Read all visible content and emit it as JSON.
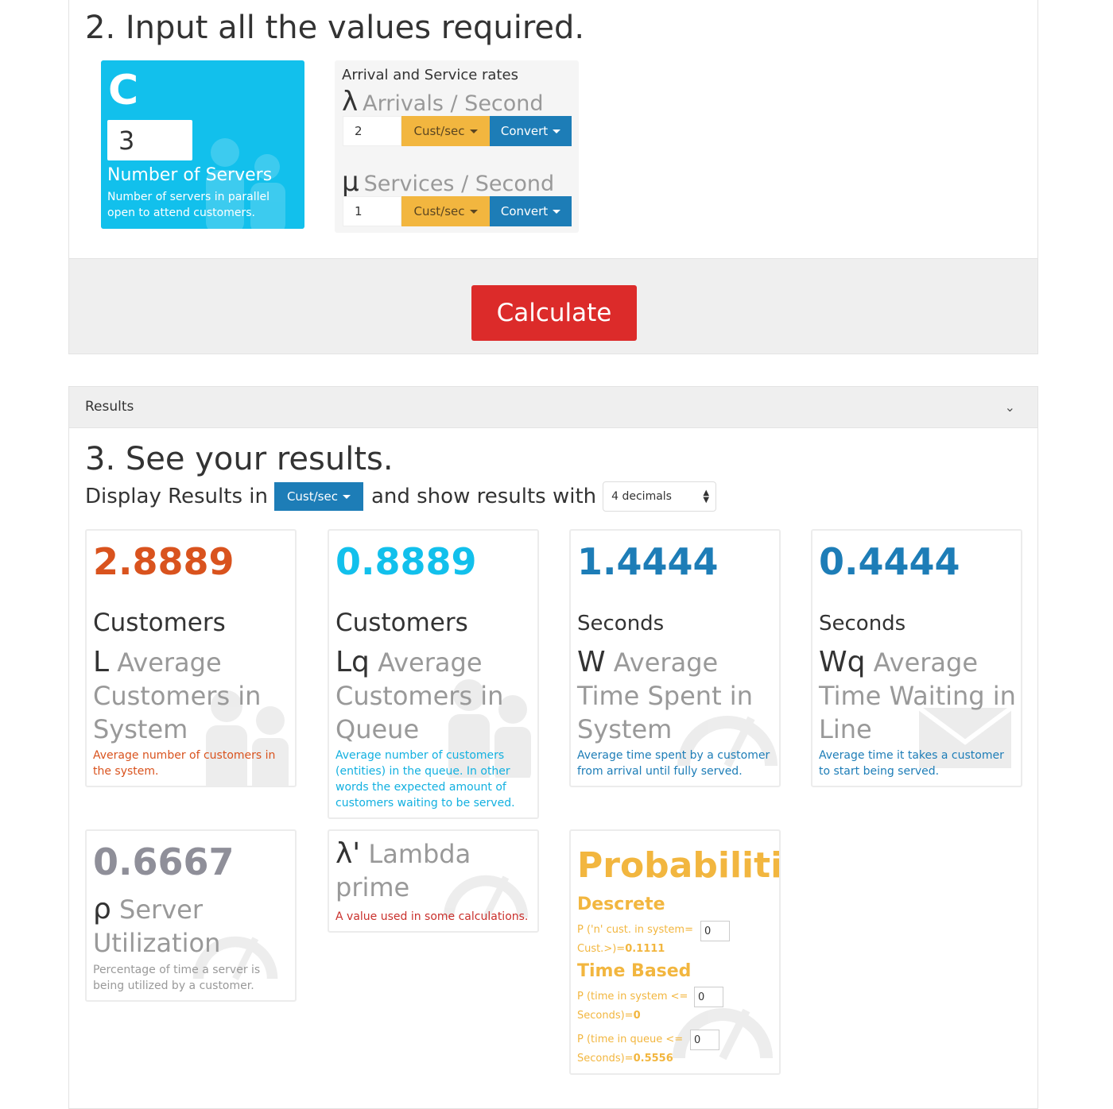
{
  "inputs": {
    "heading": "2. Input all the values required.",
    "servers": {
      "symbol": "C",
      "value": "3",
      "title": "Number of Servers",
      "description": "Number of servers in parallel open to attend customers."
    },
    "rates": {
      "title": "Arrival and Service rates",
      "arrivals": {
        "symbol": "λ",
        "label": "Arrivals / Second",
        "value": "2",
        "unit_button": "Cust/sec",
        "convert_button": "Convert"
      },
      "services": {
        "symbol": "μ",
        "label": "Services / Second",
        "value": "1",
        "unit_button": "Cust/sec",
        "convert_button": "Convert"
      }
    },
    "calculate_button": "Calculate"
  },
  "results": {
    "panel_title": "Results",
    "heading": "3. See your results.",
    "display_prefix": "Display Results in",
    "display_unit": "Cust/sec",
    "display_middle": "and show results with",
    "decimals": "4 decimals",
    "colors": {
      "orange": "#d9531e",
      "cyan": "#12c0ec",
      "blue": "#1d7db7",
      "gray": "#8f8f99",
      "red": "#c9302c",
      "yellow": "#f2b63f"
    },
    "cards": [
      {
        "value": "2.8889",
        "unit": "Customers",
        "symbol": "L",
        "name": "Average Customers in System",
        "description": "Average number of customers in the system."
      },
      {
        "value": "0.8889",
        "unit": "Customers",
        "symbol": "Lq",
        "name": "Average Customers in Queue",
        "description": "Average number of customers (entities) in the queue. In other words the expected amount of customers waiting to be served."
      },
      {
        "value": "1.4444",
        "unit": "Seconds",
        "symbol": "W",
        "name": "Average Time Spent in System",
        "description": "Average time spent by a customer from arrival until fully served."
      },
      {
        "value": "0.4444",
        "unit": "Seconds",
        "symbol": "Wq",
        "name": "Average Time Waiting in Line",
        "description": "Average time it takes a customer to start being served."
      },
      {
        "value": "0.6667",
        "symbol": "ρ",
        "name": "Server Utilization",
        "description": "Percentage of time a server is being utilized by a customer."
      },
      {
        "symbol": "λ'",
        "name": "Lambda prime",
        "description": "A value used in some calculations."
      }
    ],
    "probabilities": {
      "title": "Probabilities",
      "discrete_heading": "Descrete",
      "discrete_label": "P ('n' cust. in system=",
      "discrete_input": "0",
      "discrete_result_label": "Cust.>)=",
      "discrete_result": "0.1111",
      "time_heading": "Time Based",
      "system_label": "P (time in system <=",
      "system_input": "0",
      "system_result_label": "Seconds)=",
      "system_result": "0",
      "queue_label": "P (time in queue <=",
      "queue_input": "0",
      "queue_result_label": "Seconds)=",
      "queue_result": "0.5556"
    }
  }
}
